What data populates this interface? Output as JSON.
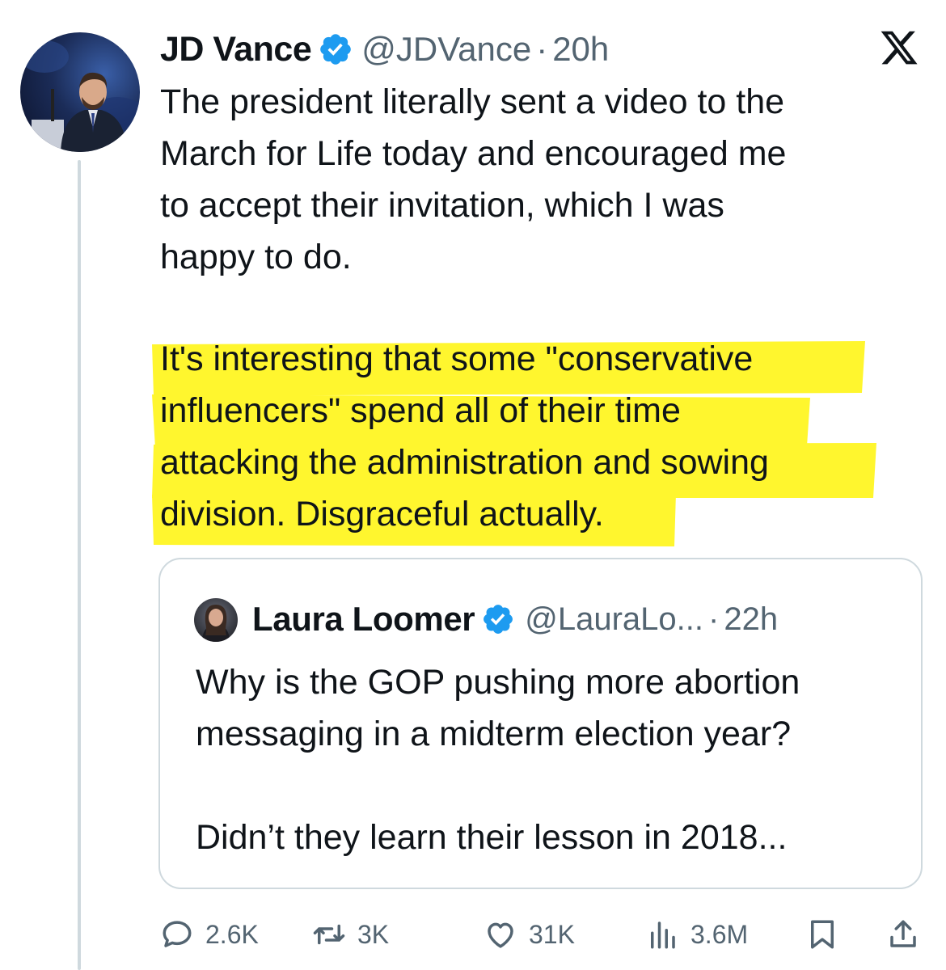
{
  "tweet": {
    "author_name": "JD Vance",
    "author_handle": "@JDVance",
    "separator": "·",
    "time": "20h",
    "paragraph1": "The president literally sent a video to the\nMarch for Life today and encouraged me\nto accept their invitation, which I was\nhappy to do.",
    "paragraph2": "It's interesting that some \"conservative\ninfluencers\" spend all of their time\nattacking the administration and sowing\ndivision. Disgraceful actually."
  },
  "quoted": {
    "author_name": "Laura Loomer",
    "author_handle": "@LauraLo...",
    "separator": "·",
    "time": "22h",
    "text": "Why is the GOP pushing more abortion\nmessaging in a midterm election year?\n\nDidn’t they learn their lesson in 2018..."
  },
  "actions": {
    "replies": "2.6K",
    "reposts": "3K",
    "likes": "31K",
    "views": "3.6M"
  },
  "colors": {
    "text": "#0f1419",
    "secondary": "#536471",
    "verified_badge": "#1d9bf0",
    "highlight": "#fff62e",
    "border": "#cfd9de"
  },
  "icons": [
    "verified-badge-icon",
    "x-logo-icon",
    "reply-icon",
    "repost-icon",
    "like-icon",
    "views-icon",
    "bookmark-icon",
    "share-icon"
  ]
}
